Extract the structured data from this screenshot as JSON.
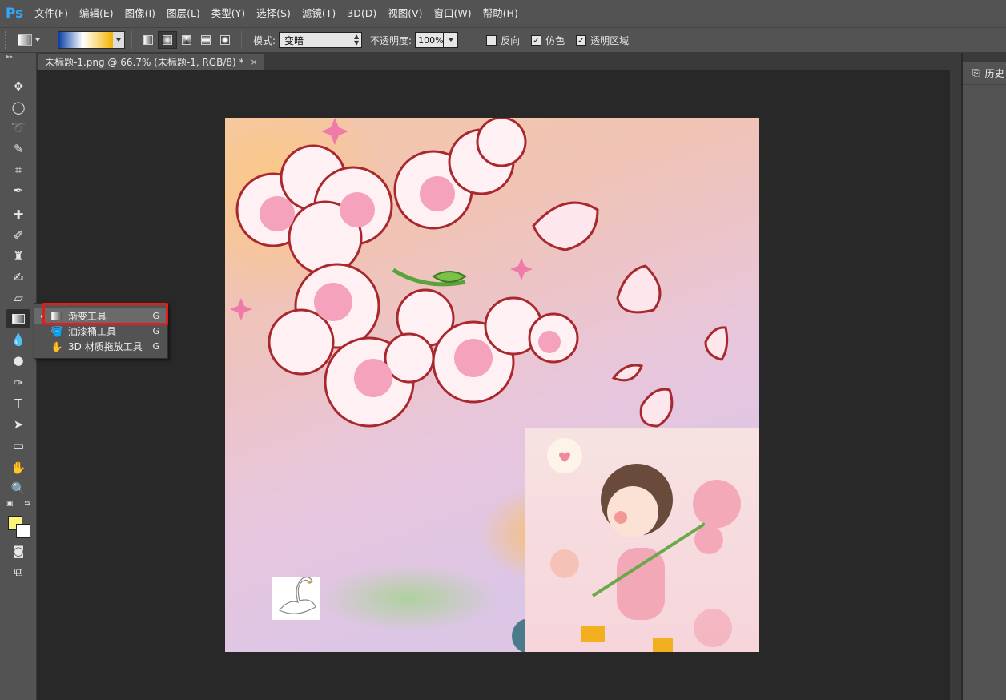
{
  "app": {
    "logo": "Ps"
  },
  "menu": [
    "文件(F)",
    "编辑(E)",
    "图像(I)",
    "图层(L)",
    "类型(Y)",
    "选择(S)",
    "滤镜(T)",
    "3D(D)",
    "视图(V)",
    "窗口(W)",
    "帮助(H)"
  ],
  "options": {
    "mode_label": "模式:",
    "mode_value": "变暗",
    "opacity_label": "不透明度:",
    "opacity_value": "100%",
    "reverse_label": "反向",
    "reverse_checked": false,
    "dither_label": "仿色",
    "dither_checked": true,
    "transparency_label": "透明区域",
    "transparency_checked": true,
    "gradient_colors": [
      "#0a3fa8",
      "#ffffff",
      "#f2b400"
    ]
  },
  "document": {
    "tab_title": "未标题-1.png @ 66.7% (未标题-1, RGB/8) *",
    "close_icon": "×"
  },
  "flyout": [
    {
      "label": "渐变工具",
      "shortcut": "G",
      "icon": "gradient-icon"
    },
    {
      "label": "油漆桶工具",
      "shortcut": "G",
      "icon": "paint-bucket-icon"
    },
    {
      "label": "3D 材质拖放工具",
      "shortcut": "G",
      "icon": "3d-material-drop-icon"
    }
  ],
  "swatches": {
    "foreground": "#fdf57a",
    "background": "#ffffff"
  },
  "right_panel": {
    "tab_label": "历史"
  }
}
